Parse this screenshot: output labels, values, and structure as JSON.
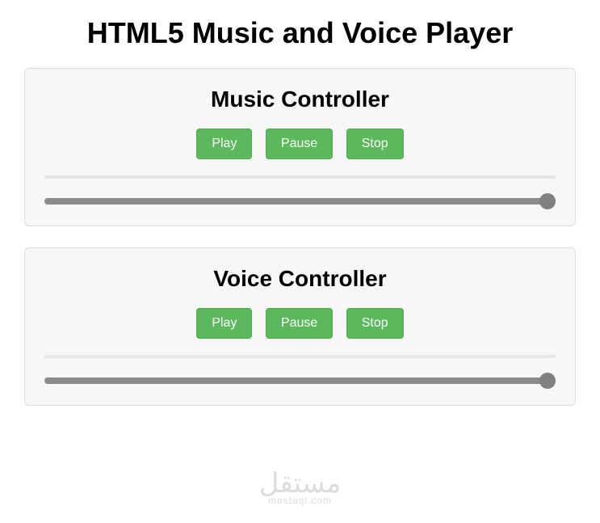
{
  "page_title": "HTML5 Music and Voice Player",
  "panels": [
    {
      "title": "Music Controller",
      "buttons": {
        "play": "Play",
        "pause": "Pause",
        "stop": "Stop"
      },
      "slider_value": 100
    },
    {
      "title": "Voice Controller",
      "buttons": {
        "play": "Play",
        "pause": "Pause",
        "stop": "Stop"
      },
      "slider_value": 100
    }
  ],
  "watermark": {
    "main": "مستقل",
    "sub": "mostaql.com"
  }
}
